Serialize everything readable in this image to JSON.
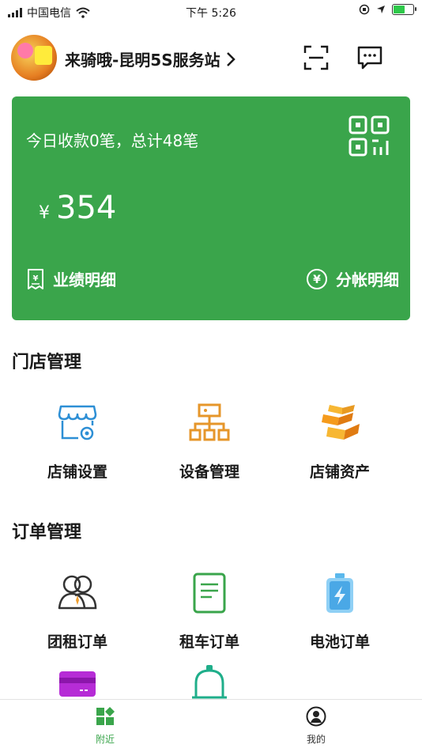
{
  "status_bar": {
    "carrier": "中国电信",
    "time": "下午 5:26"
  },
  "header": {
    "store_name": "来骑哦-昆明5S服务站",
    "chevron": ">"
  },
  "card": {
    "summary": "今日收款0笔，总计48笔",
    "currency": "¥",
    "amount": "354",
    "left_link": "业绩明细",
    "right_link": "分帐明细",
    "color": "#3aa54b"
  },
  "sections": {
    "store": {
      "title": "门店管理",
      "items": [
        {
          "label": "店铺设置",
          "icon": "store-settings-icon"
        },
        {
          "label": "设备管理",
          "icon": "device-tree-icon"
        },
        {
          "label": "店铺资产",
          "icon": "gold-bars-icon"
        }
      ]
    },
    "orders": {
      "title": "订单管理",
      "items": [
        {
          "label": "团租订单",
          "icon": "group-users-icon"
        },
        {
          "label": "租车订单",
          "icon": "document-icon"
        },
        {
          "label": "电池订单",
          "icon": "battery-icon"
        },
        {
          "label": "",
          "icon": "card-icon"
        },
        {
          "label": "",
          "icon": "bell-icon"
        }
      ]
    }
  },
  "tabbar": {
    "nearby": "附近",
    "mine": "我的",
    "active_color": "#3aa54b"
  }
}
